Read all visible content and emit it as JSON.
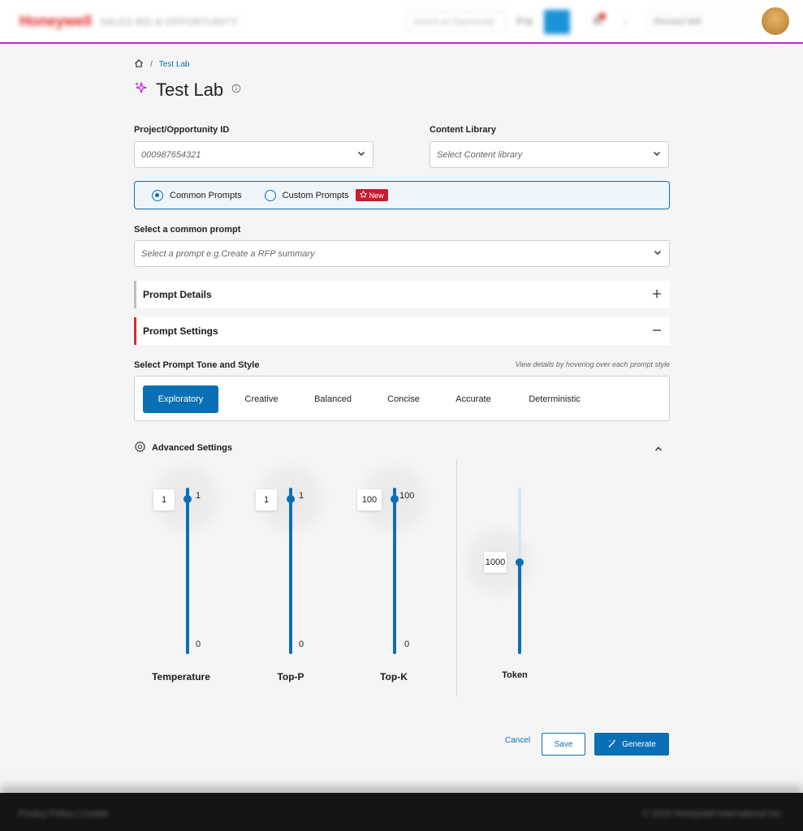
{
  "header": {
    "logo": "Honeywell",
    "app_name": "SALES BID & OPPORTUNITY",
    "search_placeholder": "Search an Opportunity",
    "lang": "Eng",
    "user": "Richard Will",
    "colors": {
      "accent": "#0b6fb5",
      "brand": "#e02424",
      "bar": "#c026d3"
    }
  },
  "breadcrumb": {
    "home_icon": "home-icon",
    "current": "Test Lab"
  },
  "page": {
    "title": "Test Lab"
  },
  "form": {
    "project_label": "Project/Opportunity ID",
    "project_value": "000987654321",
    "library_label": "Content Library",
    "library_placeholder": "Select Content library"
  },
  "prompt_type": {
    "common": "Common Prompts",
    "custom": "Custom Prompts",
    "new_badge": "New",
    "selected": "common"
  },
  "common_prompt": {
    "label": "Select a common prompt",
    "placeholder": "Select a prompt e.g.Create a RFP summary"
  },
  "panels": {
    "details": "Prompt Details",
    "settings": "Prompt Settings"
  },
  "tone": {
    "label": "Select Prompt Tone and Style",
    "hint": "View details by hovering over each prompt style",
    "options": [
      "Exploratory",
      "Creative",
      "Balanced",
      "Concise",
      "Accurate",
      "Deterministic"
    ],
    "active": "Exploratory"
  },
  "advanced": {
    "label": "Advanced Settings"
  },
  "sliders": [
    {
      "name": "Temperature",
      "value": "1",
      "max": "1",
      "min": "0",
      "level": 1.0
    },
    {
      "name": "Top-P",
      "value": "1",
      "max": "1",
      "min": "0",
      "level": 1.0
    },
    {
      "name": "Top-K",
      "value": "100",
      "max": "100",
      "min": "0",
      "level": 1.0
    },
    {
      "name": "Token",
      "value": "1000",
      "level": 0.55
    }
  ],
  "actions": {
    "cancel": "Cancel",
    "save": "Save",
    "generate": "Generate"
  },
  "footer": {
    "left": "Privacy Policy | Cookie",
    "right": "© 2024 Honeywell International Inc."
  }
}
